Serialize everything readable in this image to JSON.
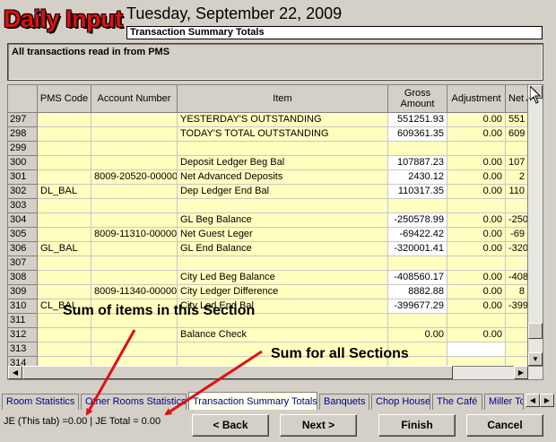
{
  "header": {
    "logo_text": "Daily Input",
    "date": "Tuesday, September 22, 2009",
    "section_title": "Transaction Summary Totals",
    "description": "All transactions read in from PMS"
  },
  "grid": {
    "columns": [
      "",
      "PMS Code",
      "Account Number",
      "Item",
      "Gross Amount",
      "Adjustment",
      "Net A"
    ],
    "rows": [
      {
        "n": "297",
        "pms": "",
        "acct": "",
        "item": "YESTERDAY'S OUTSTANDING",
        "gross": "551251.93",
        "adj": "0.00",
        "net": "551"
      },
      {
        "n": "298",
        "pms": "",
        "acct": "",
        "item": "TODAY'S TOTAL OUTSTANDING",
        "gross": "609361.35",
        "adj": "0.00",
        "net": "609"
      },
      {
        "n": "299",
        "pms": "",
        "acct": "",
        "item": "",
        "gross": "",
        "adj": "",
        "net": ""
      },
      {
        "n": "300",
        "pms": "",
        "acct": "",
        "item": "Deposit Ledger Beg Bal",
        "gross": "107887.23",
        "adj": "0.00",
        "net": "107"
      },
      {
        "n": "301",
        "pms": "",
        "acct": "8009-20520-00000",
        "item": "Net Advanced Deposits",
        "gross": "2430.12",
        "adj": "0.00",
        "net": "2"
      },
      {
        "n": "302",
        "pms": "DL_BAL",
        "acct": "",
        "item": "Dep Ledger End Bal",
        "gross": "110317.35",
        "adj": "0.00",
        "net": "110"
      },
      {
        "n": "303",
        "pms": "",
        "acct": "",
        "item": "",
        "gross": "",
        "adj": "",
        "net": ""
      },
      {
        "n": "304",
        "pms": "",
        "acct": "",
        "item": "GL Beg Balance",
        "gross": "-250578.99",
        "adj": "0.00",
        "net": "-250"
      },
      {
        "n": "305",
        "pms": "",
        "acct": "8009-11310-00000",
        "item": "Net Guest Leger",
        "gross": "-69422.42",
        "adj": "0.00",
        "net": "-69"
      },
      {
        "n": "306",
        "pms": "GL_BAL",
        "acct": "",
        "item": "GL End Balance",
        "gross": "-320001.41",
        "adj": "0.00",
        "net": "-320"
      },
      {
        "n": "307",
        "pms": "",
        "acct": "",
        "item": "",
        "gross": "",
        "adj": "",
        "net": ""
      },
      {
        "n": "308",
        "pms": "",
        "acct": "",
        "item": "City Led Beg Balance",
        "gross": "-408560.17",
        "adj": "0.00",
        "net": "-408"
      },
      {
        "n": "309",
        "pms": "",
        "acct": "8009-11340-00000",
        "item": "City Ledger Difference",
        "gross": "8882.88",
        "adj": "0.00",
        "net": "8"
      },
      {
        "n": "310",
        "pms": "CL_BAL",
        "acct": "",
        "item": "City Led End Bal",
        "gross": "-399677.29",
        "adj": "0.00",
        "net": "-399"
      },
      {
        "n": "311",
        "pms": "",
        "acct": "",
        "item": "",
        "gross": "",
        "adj": "",
        "net": ""
      },
      {
        "n": "312",
        "pms": "",
        "acct": "",
        "item": "Balance Check",
        "gross": "0.00",
        "adj": "0.00",
        "net": ""
      },
      {
        "n": "313",
        "pms": "",
        "acct": "",
        "item": "",
        "gross": "",
        "adj": "",
        "net": ""
      },
      {
        "n": "314",
        "pms": "",
        "acct": "",
        "item": "",
        "gross": "",
        "adj": "",
        "net": ""
      }
    ]
  },
  "tabs": [
    {
      "label": "Room Statistics",
      "active": false
    },
    {
      "label": "Other Rooms Statistics",
      "active": false
    },
    {
      "label": "Transaction Summary Totals",
      "active": true
    },
    {
      "label": "Banquets",
      "active": false
    },
    {
      "label": "Chop House",
      "active": false
    },
    {
      "label": "The Café",
      "active": false
    },
    {
      "label": "Miller To",
      "active": false
    }
  ],
  "status": {
    "text": "JE (This tab) =0.00 | JE Total = 0.00"
  },
  "buttons": {
    "back": "< Back",
    "next": "Next >",
    "finish": "Finish",
    "cancel": "Cancel"
  },
  "annotations": {
    "section_sum": "Sum of items in this Section",
    "all_sum": "Sum for all Sections"
  },
  "colors": {
    "logo": "#e01010",
    "cell_bg": "#ffffc0",
    "tab_text": "#00008b",
    "arrow": "#e01010"
  },
  "icons": {
    "scroll_up": "triangle-up",
    "scroll_down": "triangle-down",
    "scroll_left": "triangle-left",
    "scroll_right": "triangle-right",
    "tab_left": "triangle-left",
    "tab_right": "triangle-right",
    "cursor": "arrow-cursor"
  }
}
